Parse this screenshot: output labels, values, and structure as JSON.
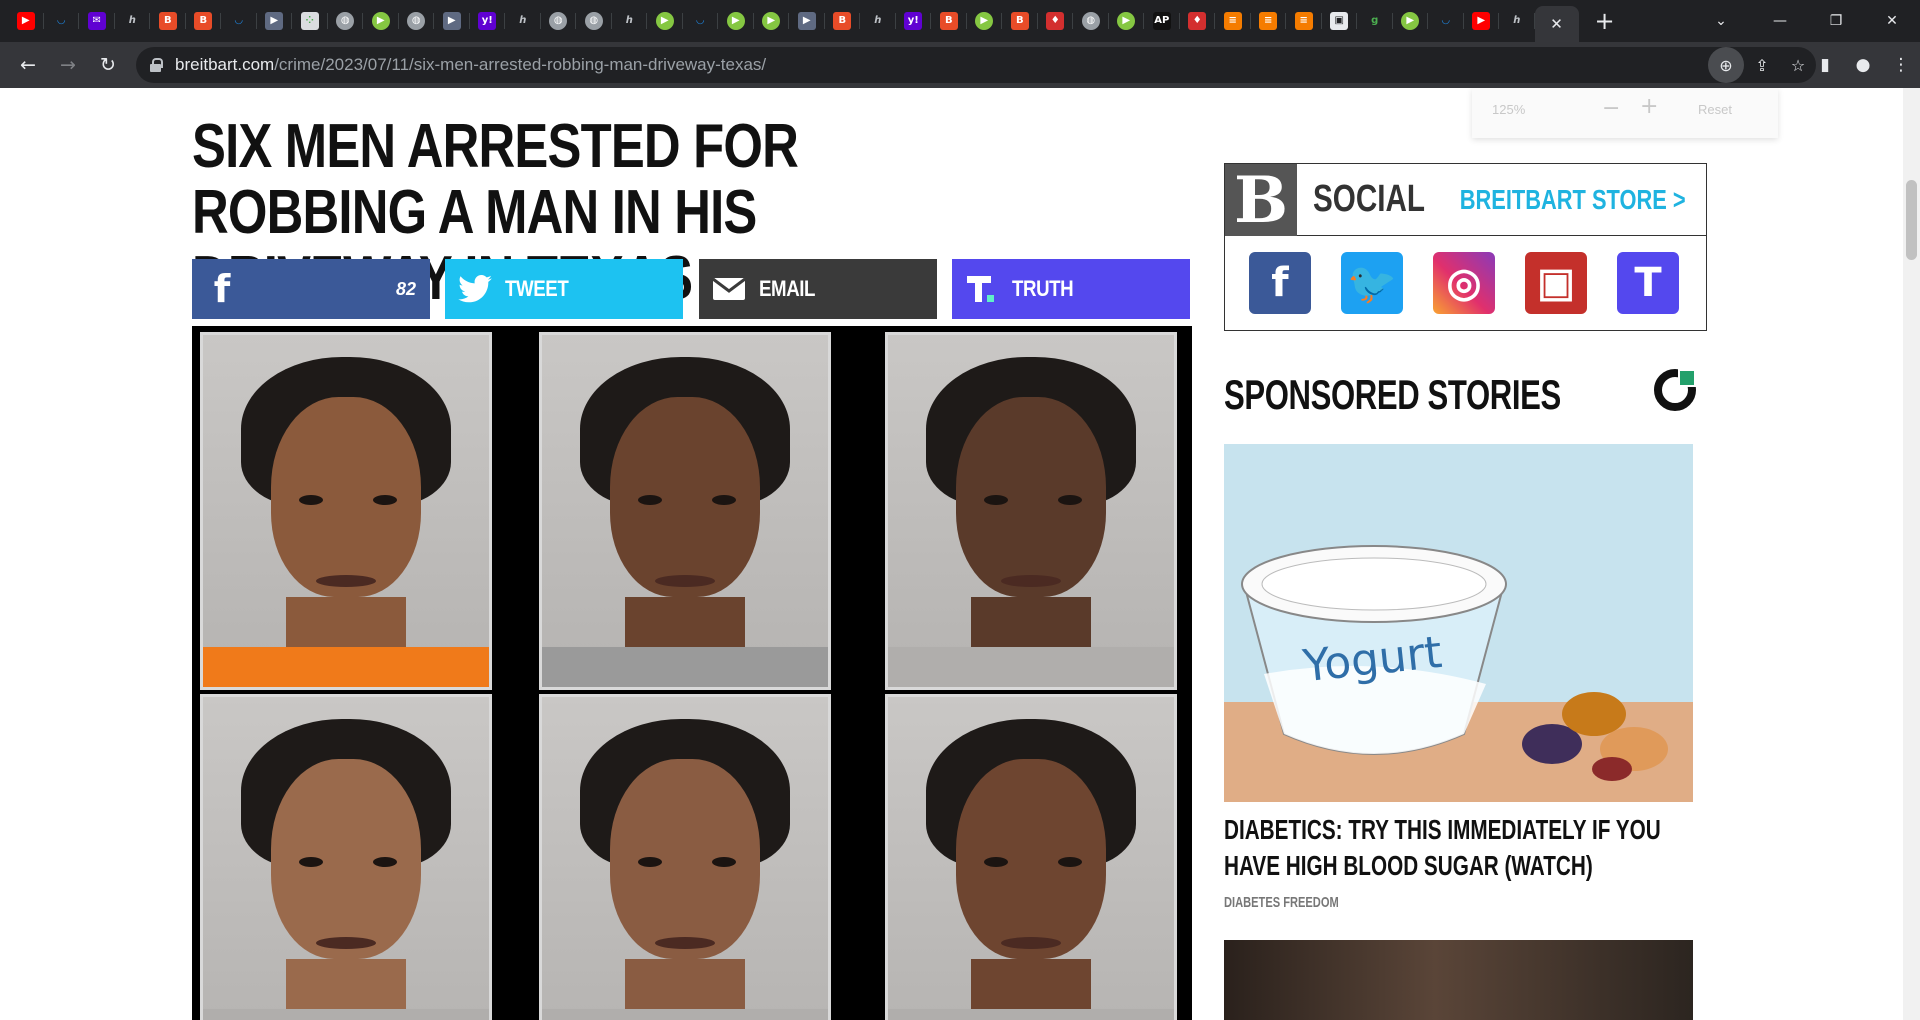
{
  "browser": {
    "tabs": [
      {
        "icon": "youtube-icon",
        "glyph": "▶",
        "bg": "#ff0000",
        "shape": "square"
      },
      {
        "icon": "shield-icon",
        "glyph": "◡",
        "bg": "#202124",
        "color": "#1e88e5",
        "shape": "square"
      },
      {
        "icon": "mail-icon",
        "glyph": "✉",
        "bg": "#6001d2",
        "shape": "square"
      },
      {
        "icon": "hyphen-icon",
        "glyph": "ℎ",
        "bg": "#202124",
        "color": "#bdc1c6",
        "shape": "square"
      },
      {
        "icon": "breitbart-icon",
        "glyph": "B",
        "bg": "#e84c28",
        "shape": "square"
      },
      {
        "icon": "breitbart-icon",
        "glyph": "B",
        "bg": "#e84c28",
        "shape": "square"
      },
      {
        "icon": "shield-icon",
        "glyph": "◡",
        "bg": "#202124",
        "color": "#1e88e5",
        "shape": "square"
      },
      {
        "icon": "arrow-tag-icon",
        "glyph": "▶",
        "bg": "#5f6a82",
        "shape": "square"
      },
      {
        "icon": "dots-icon",
        "glyph": "⁘",
        "bg": "#dadce0",
        "color": "#4caf50",
        "shape": "square"
      },
      {
        "icon": "globe-icon",
        "glyph": "◍",
        "bg": "#9aa0a6",
        "shape": "circle"
      },
      {
        "icon": "rumble-icon",
        "glyph": "▶",
        "bg": "#85c742",
        "shape": "circle"
      },
      {
        "icon": "globe-icon",
        "glyph": "◍",
        "bg": "#9aa0a6",
        "shape": "circle"
      },
      {
        "icon": "arrow-tag-icon",
        "glyph": "▶",
        "bg": "#5f6a82",
        "shape": "square"
      },
      {
        "icon": "yahoo-icon",
        "glyph": "y!",
        "bg": "#6001d2",
        "shape": "square"
      },
      {
        "icon": "hyphen-icon",
        "glyph": "ℎ",
        "bg": "#202124",
        "color": "#bdc1c6",
        "shape": "square"
      },
      {
        "icon": "globe-icon",
        "glyph": "◍",
        "bg": "#9aa0a6",
        "shape": "circle"
      },
      {
        "icon": "globe-icon",
        "glyph": "◍",
        "bg": "#9aa0a6",
        "shape": "circle"
      },
      {
        "icon": "hyphen-icon",
        "glyph": "ℎ",
        "bg": "#202124",
        "color": "#bdc1c6",
        "shape": "square"
      },
      {
        "icon": "rumble-icon",
        "glyph": "▶",
        "bg": "#85c742",
        "shape": "circle"
      },
      {
        "icon": "shield-icon",
        "glyph": "◡",
        "bg": "#202124",
        "color": "#1e88e5",
        "shape": "square"
      },
      {
        "icon": "rumble-icon",
        "glyph": "▶",
        "bg": "#85c742",
        "shape": "circle"
      },
      {
        "icon": "rumble-icon",
        "glyph": "▶",
        "bg": "#85c742",
        "shape": "circle"
      },
      {
        "icon": "arrow-tag-icon",
        "glyph": "▶",
        "bg": "#5f6a82",
        "shape": "square"
      },
      {
        "icon": "breitbart-icon",
        "glyph": "B",
        "bg": "#e84c28",
        "shape": "square"
      },
      {
        "icon": "hyphen-icon",
        "glyph": "ℎ",
        "bg": "#202124",
        "color": "#bdc1c6",
        "shape": "square"
      },
      {
        "icon": "yahoo-icon",
        "glyph": "y!",
        "bg": "#6001d2",
        "shape": "square"
      },
      {
        "icon": "breitbart-icon",
        "glyph": "B",
        "bg": "#e84c28",
        "shape": "square"
      },
      {
        "icon": "rumble-icon",
        "glyph": "▶",
        "bg": "#85c742",
        "shape": "circle"
      },
      {
        "icon": "breitbart-icon",
        "glyph": "B",
        "bg": "#e84c28",
        "shape": "square"
      },
      {
        "icon": "pin-icon",
        "glyph": "♦",
        "bg": "#d32f2f",
        "shape": "square"
      },
      {
        "icon": "globe-icon",
        "glyph": "◍",
        "bg": "#9aa0a6",
        "shape": "circle"
      },
      {
        "icon": "rumble-icon",
        "glyph": "▶",
        "bg": "#85c742",
        "shape": "circle"
      },
      {
        "icon": "ap-icon",
        "glyph": "AP",
        "bg": "#111111",
        "shape": "square"
      },
      {
        "icon": "pin-icon",
        "glyph": "♦",
        "bg": "#d32f2f",
        "shape": "square"
      },
      {
        "icon": "stack-icon",
        "glyph": "≡",
        "bg": "#f57c00",
        "shape": "square"
      },
      {
        "icon": "stack-icon",
        "glyph": "≡",
        "bg": "#f57c00",
        "shape": "square"
      },
      {
        "icon": "stack-icon",
        "glyph": "≡",
        "bg": "#f57c00",
        "shape": "square"
      },
      {
        "icon": "lock-page-icon",
        "glyph": "▣",
        "bg": "#e8eaed",
        "color": "#202124",
        "shape": "square"
      },
      {
        "icon": "g-icon",
        "glyph": "g",
        "bg": "#202124",
        "color": "#4caf50",
        "shape": "square"
      },
      {
        "icon": "rumble-icon",
        "glyph": "▶",
        "bg": "#85c742",
        "shape": "circle"
      },
      {
        "icon": "shield-icon",
        "glyph": "◡",
        "bg": "#202124",
        "color": "#1e88e5",
        "shape": "square"
      },
      {
        "icon": "youtube-icon",
        "glyph": "▶",
        "bg": "#ff0000",
        "shape": "square"
      },
      {
        "icon": "hyphen-icon",
        "glyph": "ℎ",
        "bg": "#202124",
        "color": "#bdc1c6",
        "shape": "square"
      }
    ],
    "active_tab_close": "✕",
    "new_tab": "+",
    "tab_search": "⌄",
    "window": {
      "minimize": "—",
      "restore": "❐",
      "close": "✕"
    },
    "nav": {
      "back": "←",
      "forward": "→",
      "reload": "↻"
    },
    "url_host": "breitbart.com",
    "url_path": "/crime/2023/07/11/six-men-arrested-robbing-man-driveway-texas/",
    "omni_icons": {
      "zoom": "⊕",
      "share": "⇪",
      "bookmark": "☆"
    },
    "toolbar_icons": {
      "sidepanel": "▮",
      "profile": "●",
      "menu": "⋮"
    }
  },
  "zoom_popup": {
    "level": "125%",
    "minus": "−",
    "plus": "+",
    "reset": "Reset"
  },
  "article": {
    "headline": "Six Men Arrested for Robbing a Man in His Driveway in Texas",
    "share": {
      "facebook_glyph": "f",
      "facebook_count": "82",
      "tweet_label": "TWEET",
      "email_label": "EMAIL",
      "truth_label": "TRUTH"
    },
    "mugshots": [
      {
        "skin": "#8b5a3c",
        "shirt": "#f07a1a"
      },
      {
        "skin": "#6a432e",
        "shirt": "#9a9a9a"
      },
      {
        "skin": "#5a3a2a",
        "shirt": "#b0aeac"
      },
      {
        "skin": "#9a6a4c",
        "shirt": "#b0aeac"
      },
      {
        "skin": "#8a5c42",
        "shirt": "#b0aeac"
      },
      {
        "skin": "#6e4530",
        "shirt": "#b0aeac"
      }
    ]
  },
  "sidebar": {
    "social": {
      "logo_letter": "B",
      "title": "SOCIAL",
      "store_link": "BREITBART STORE >",
      "icons": [
        {
          "name": "facebook-icon",
          "glyph": "f",
          "cls": "fb"
        },
        {
          "name": "twitter-icon",
          "glyph": "🐦",
          "cls": "tw"
        },
        {
          "name": "instagram-icon",
          "glyph": "◎",
          "cls": "ig"
        },
        {
          "name": "youtube-icon",
          "glyph": "▣",
          "cls": "yt"
        },
        {
          "name": "truth-social-icon",
          "glyph": "T",
          "cls": "tr"
        }
      ]
    },
    "sponsored": {
      "title": "SPONSORED STORIES",
      "story1": {
        "image_text": "Yogurt",
        "title": "Diabetics: Try This Immediately If You Have High Blood Sugar (Watch)",
        "source": "Diabetes Freedom"
      }
    }
  }
}
